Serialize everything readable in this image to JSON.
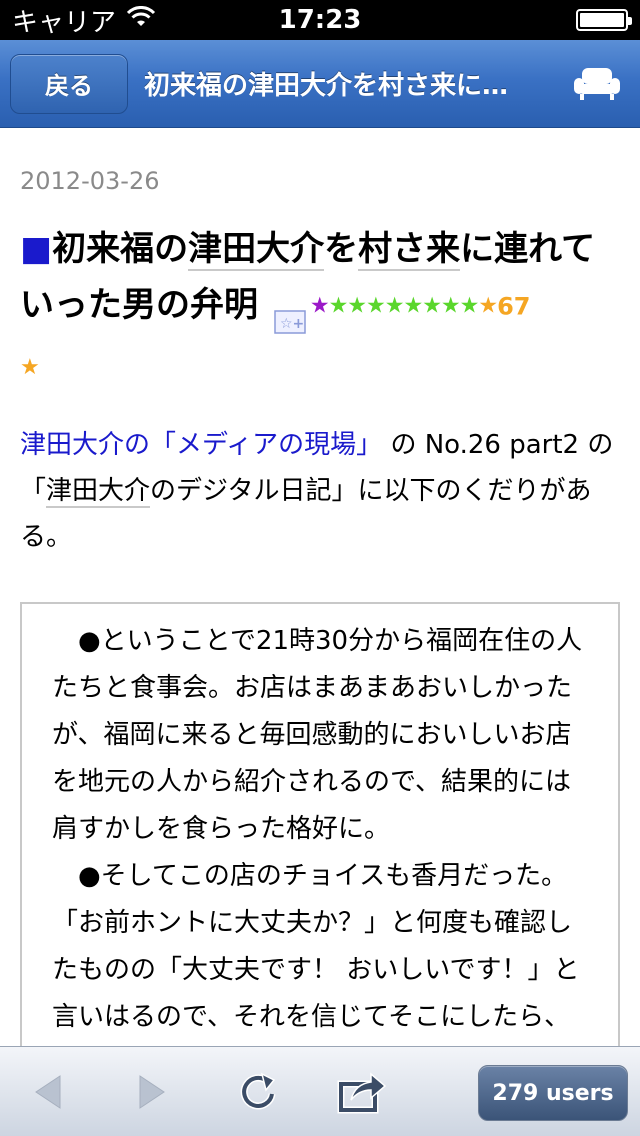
{
  "status": {
    "carrier": "キャリア",
    "time": "17:23"
  },
  "nav": {
    "back_label": "戻る",
    "title": "初来福の津田大介を村さ来に…"
  },
  "entry": {
    "date": "2012-03-26",
    "title_parts": [
      "初来福の",
      "津田大介",
      "を",
      "村さ来",
      "に連れていった男の弁明"
    ],
    "star_count": "67"
  },
  "intro": {
    "link_text": "津田大介の「メディアの現場」",
    "text1": "の No.26 part2 の「",
    "kw": "津田大介",
    "text2": "のデジタル日記」に以下のくだりがある。"
  },
  "quote": {
    "p1": "●ということで21時30分から福岡在住の人たちと食事会。お店はまあまあおいしかったが、福岡に来ると毎回感動的においしいお店を地元の人から紹介されるので、結果的には肩すかしを食らった格好に。",
    "p2": "●そしてこの店のチョイスも香月だった。「お前ホントに大丈夫か？」と何度も確認したものの「大丈夫です！ おいしいです！」と言いはるので、それを信じてそこにしたら、残念な結果に終わった。もう二度と福岡での店選び"
  },
  "toolbar": {
    "users_label": "279 users"
  }
}
